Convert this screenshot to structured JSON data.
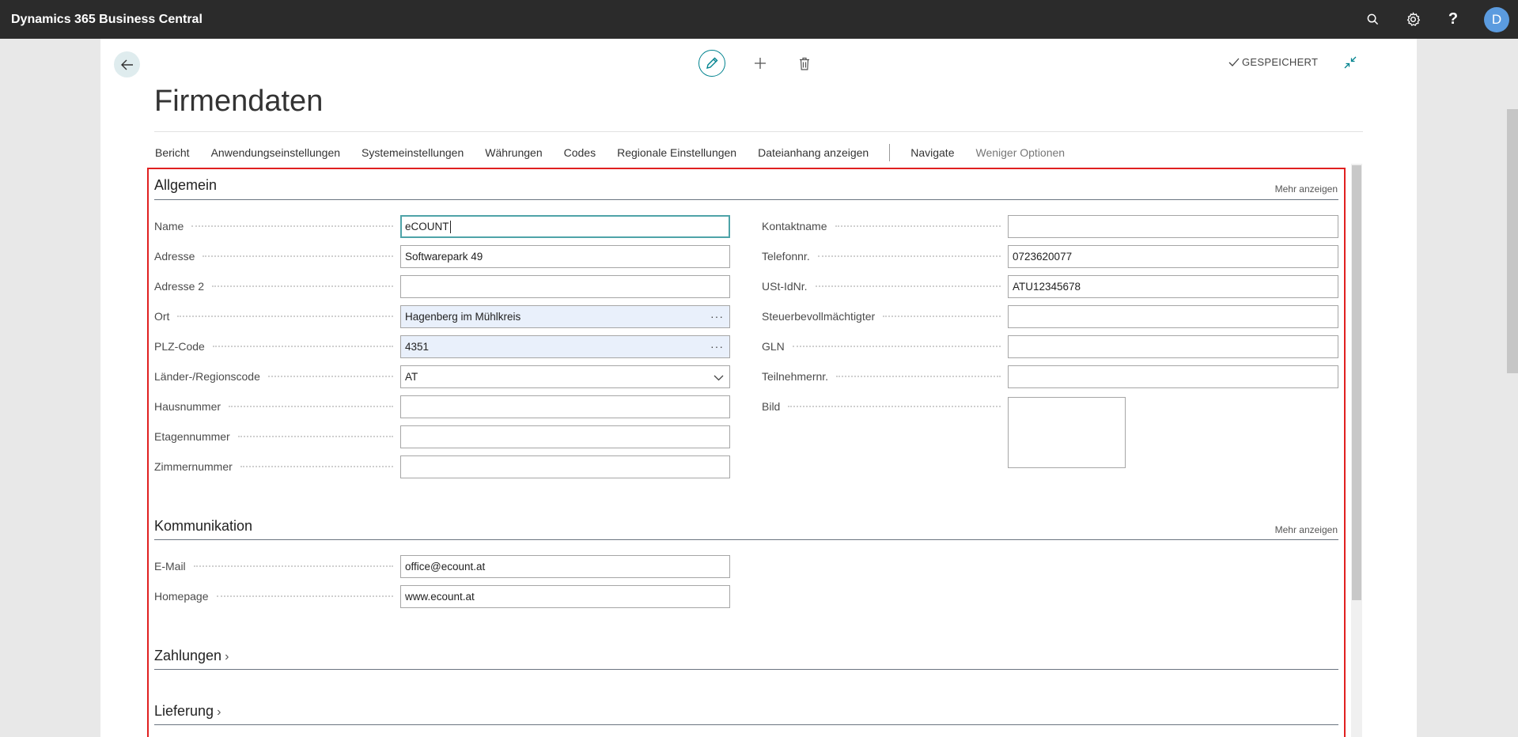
{
  "app": {
    "title": "Dynamics 365 Business Central",
    "user_initial": "D"
  },
  "header": {
    "saved_label": "GESPEICHERT"
  },
  "page": {
    "title": "Firmendaten"
  },
  "actions": [
    "Bericht",
    "Anwendungseinstellungen",
    "Systemeinstellungen",
    "Währungen",
    "Codes",
    "Regionale Einstellungen",
    "Dateianhang anzeigen",
    "Navigate",
    "Weniger Optionen"
  ],
  "sections": {
    "general": {
      "title": "Allgemein",
      "more": "Mehr anzeigen",
      "left": [
        {
          "label": "Name",
          "value": "eCOUNT",
          "focused": true
        },
        {
          "label": "Adresse",
          "value": "Softwarepark 49"
        },
        {
          "label": "Adresse 2",
          "value": ""
        },
        {
          "label": "Ort",
          "value": "Hagenberg im Mühlkreis",
          "assist": "···"
        },
        {
          "label": "PLZ-Code",
          "value": "4351",
          "assist": "···"
        },
        {
          "label": "Länder-/Regionscode",
          "value": "AT",
          "dropdown": true
        },
        {
          "label": "Hausnummer",
          "value": ""
        },
        {
          "label": "Etagennummer",
          "value": ""
        },
        {
          "label": "Zimmernummer",
          "value": ""
        }
      ],
      "right": [
        {
          "label": "Kontaktname",
          "value": ""
        },
        {
          "label": "Telefonnr.",
          "value": "0723620077"
        },
        {
          "label": "USt-IdNr.",
          "value": "ATU12345678"
        },
        {
          "label": "Steuerbevollmächtigter",
          "value": ""
        },
        {
          "label": "GLN",
          "value": ""
        },
        {
          "label": "Teilnehmernr.",
          "value": ""
        },
        {
          "label": "Bild",
          "value": ""
        }
      ]
    },
    "communication": {
      "title": "Kommunikation",
      "more": "Mehr anzeigen",
      "fields": [
        {
          "label": "E-Mail",
          "value": "office@ecount.at"
        },
        {
          "label": "Homepage",
          "value": "www.ecount.at"
        }
      ]
    },
    "payments": {
      "title": "Zahlungen"
    },
    "delivery": {
      "title": "Lieferung"
    }
  }
}
